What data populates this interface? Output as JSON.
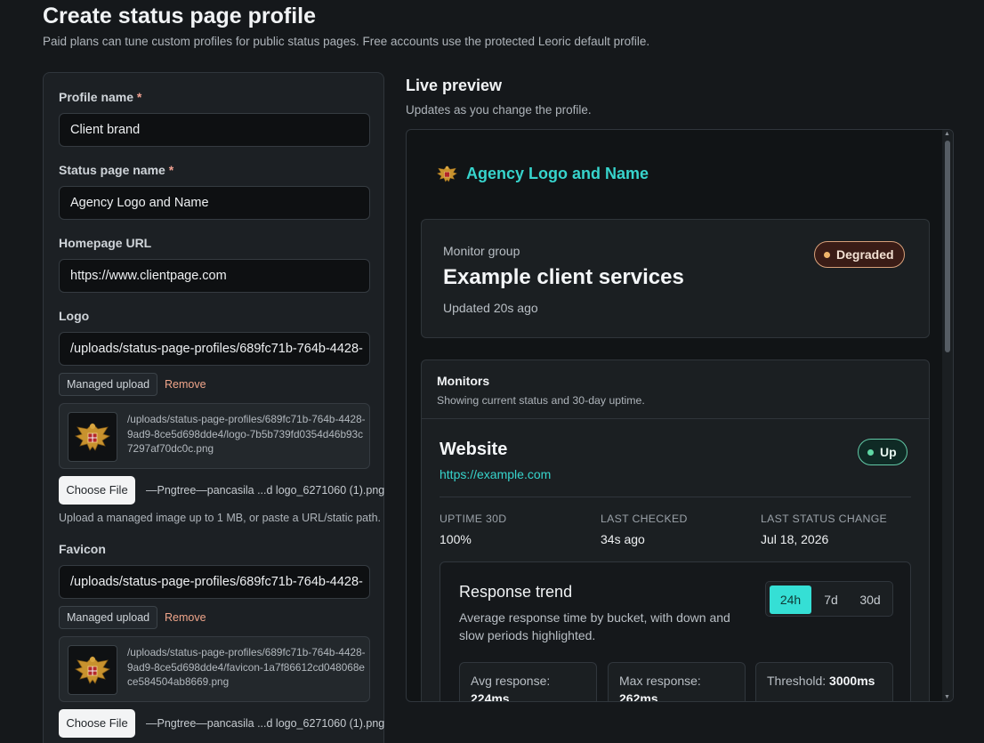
{
  "page": {
    "title": "Create status page profile",
    "subtitle": "Paid plans can tune custom profiles for public status pages. Free accounts use the protected Leoric default profile."
  },
  "form": {
    "profile_name_label": "Profile name",
    "profile_name_value": "Client brand",
    "status_page_name_label": "Status page name",
    "status_page_name_value": "Agency Logo and Name",
    "homepage_label": "Homepage URL",
    "homepage_value": "https://www.clientpage.com",
    "required_mark": "*",
    "logo": {
      "label": "Logo",
      "value": "/uploads/status-page-profiles/689fc71b-764b-4428-",
      "managed_label": "Managed upload",
      "remove_label": "Remove",
      "path": "/uploads/status-page-profiles/689fc71b-764b-4428-9ad9-8ce5d698dde4/logo-7b5b739fd0354d46b93c7297af70dc0c.png",
      "choose_label": "Choose File",
      "file_name": "—Pngtree—pancasila ...d logo_6271060 (1).png",
      "helper": "Upload a managed image up to 1 MB, or paste a URL/static path."
    },
    "favicon": {
      "label": "Favicon",
      "value": "/uploads/status-page-profiles/689fc71b-764b-4428-",
      "managed_label": "Managed upload",
      "remove_label": "Remove",
      "path": "/uploads/status-page-profiles/689fc71b-764b-4428-9ad9-8ce5d698dde4/favicon-1a7f86612cd048068ece584504ab8669.png",
      "choose_label": "Choose File",
      "file_name": "—Pngtree—pancasila ...d logo_6271060 (1).png"
    }
  },
  "preview": {
    "title": "Live preview",
    "subtitle": "Updates as you change the profile.",
    "brand_name": "Agency Logo and Name",
    "group": {
      "label": "Monitor group",
      "title": "Example client services",
      "updated": "Updated 20s ago",
      "status": "Degraded"
    },
    "monitors": {
      "heading": "Monitors",
      "subheading": "Showing current status and 30-day uptime.",
      "website": {
        "name": "Website",
        "url": "https://example.com",
        "status": "Up",
        "stats": [
          {
            "key": "UPTIME 30D",
            "value": "100%"
          },
          {
            "key": "LAST CHECKED",
            "value": "34s ago"
          },
          {
            "key": "LAST STATUS CHANGE",
            "value": "Jul 18, 2026"
          }
        ]
      }
    },
    "trend": {
      "title": "Response trend",
      "description": "Average response time by bucket, with down and slow periods highlighted.",
      "ranges": [
        "24h",
        "7d",
        "30d"
      ],
      "active_range": "24h",
      "avg_label": "Avg response:",
      "avg_value": "224ms",
      "max_label": "Max response:",
      "max_value": "262ms",
      "threshold_label": "Threshold:",
      "threshold_value": "3000ms"
    }
  },
  "colors": {
    "accent": "#37d4cc",
    "degraded": "#f0b56b",
    "up": "#5fd7a4",
    "remove": "#f0a58a"
  }
}
